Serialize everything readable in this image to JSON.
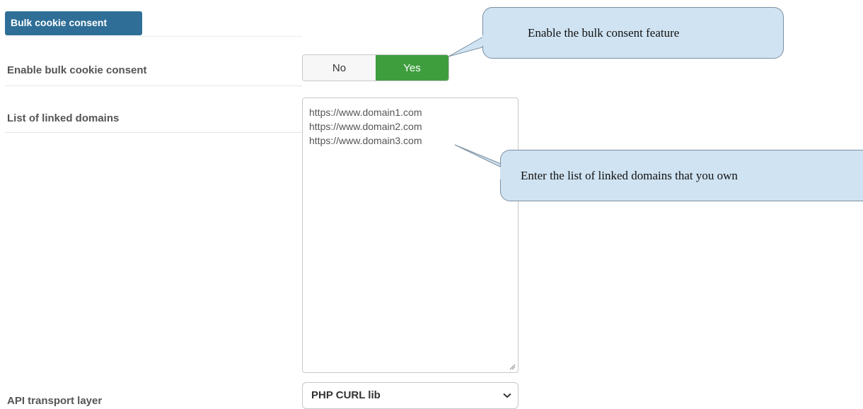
{
  "section": {
    "title": "Bulk cookie consent"
  },
  "rows": {
    "enable": {
      "label": "Enable bulk cookie consent",
      "options": [
        "No",
        "Yes"
      ],
      "selected": "Yes"
    },
    "domains": {
      "label": "List of linked domains",
      "lines": [
        "https://www.domain1.com",
        "https://www.domain2.com",
        "https://www.domain3.com"
      ]
    },
    "transport": {
      "label": "API transport layer",
      "selected": "PHP CURL lib"
    }
  },
  "callouts": {
    "enable": "Enable the bulk consent feature",
    "domains": "Enter the list of linked domains that you own"
  },
  "icons": {
    "select_chevron": "chevron-down-icon",
    "resize": "resize-grip-icon"
  },
  "colors": {
    "badge": "#2f6f97",
    "toggle_on": "#3e9e3e",
    "callout_fill": "#cfe3f2"
  }
}
